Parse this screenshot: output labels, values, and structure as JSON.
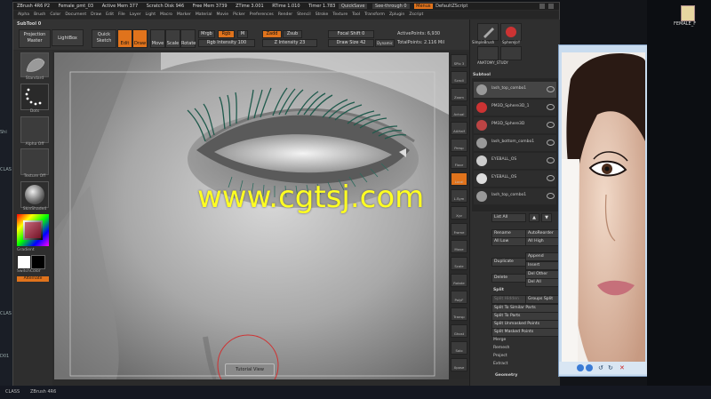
{
  "desktop": {
    "left_labels": [
      "Shi",
      "CLAS",
      "CLAS",
      "D01"
    ],
    "right_folder_label": "FEMALE_F",
    "taskbar": [
      "CLASS",
      "ZBrush 4R6"
    ]
  },
  "zbrush": {
    "title_items": [
      "ZBrush 4R6 P2",
      "Female_pmt_03",
      "Active Mem 377",
      "Scratch Disk 946",
      "Free Mem 3739",
      "ZTime 3.001",
      "RTime 1.010",
      "Timer 1.783"
    ],
    "title_right": [
      "QuickSave",
      "See-through 0",
      "Menus",
      "DefaultZScript"
    ],
    "menu": [
      "Alpha",
      "Brush",
      "Color",
      "Document",
      "Draw",
      "Edit",
      "File",
      "Layer",
      "Light",
      "Macro",
      "Marker",
      "Material",
      "Movie",
      "Picker",
      "Preferences",
      "Render",
      "Stencil",
      "Stroke",
      "Texture",
      "Tool",
      "Transform",
      "Zplugin",
      "Zscript"
    ],
    "toolbar": {
      "subtool_label": "SubTool 0",
      "projection_master": "Projection Master",
      "lightbox": "LightBox",
      "quick_sketch": "Quick Sketch",
      "edit": "Edit",
      "draw": "Draw",
      "move": "Move",
      "scale": "Scale",
      "rotate": "Rotate",
      "mrgb": "Mrgb",
      "rgb": "Rgb",
      "m": "M",
      "rgb_intensity": "Rgb Intensity 100",
      "zadd": "Zadd",
      "zsub": "Zsub",
      "z_intensity": "Z Intensity 23",
      "focal_shift": "Focal Shift 0",
      "draw_size": "Draw Size 42",
      "dynamic": "Dynamic",
      "active_points": "ActivePoints: 6,930",
      "total_points": "TotalPoints: 2.116 Mil"
    },
    "left_tray": {
      "labels": [
        "Standard",
        "Dots",
        "Alpha Off",
        "Texture Off",
        "SkinShade4",
        "Gradient",
        "SwitchColor",
        "Alternate"
      ]
    },
    "canvas": {
      "hint": "Tutorial View"
    },
    "shelf": [
      "SPix 3",
      "Scroll",
      "Zoom",
      "Actual",
      "AAHalf",
      "Persp",
      "Floor",
      "Local",
      "L.Sym",
      "Xyz",
      "Frame",
      "Move",
      "Scale",
      "Rotate",
      "PolyF",
      "Transp",
      "Ghost",
      "Solo",
      "Xpose"
    ],
    "right_tray": {
      "top_icons": [
        "SimpleBrush",
        "SphereJoY",
        "Cylinder3D",
        "PM3D_Sphere3D"
      ],
      "top_label": "ANATOMY_STUDY",
      "subtool_header": "Subtool",
      "subtools": [
        "lash_top_combo1",
        "PM3D_Sphere3D_1",
        "PM3D_Sphere3D",
        "lash_bottom_combo1",
        "EYEBALL_OS",
        "EYEBALL_OS",
        "lash_top_combo1"
      ],
      "list_all": "List All",
      "rename": "Rename",
      "auto_reorder": "AutoReorder",
      "all_low": "All Low",
      "all_high": "All High",
      "duplicate": "Duplicate",
      "append": "Append",
      "insert": "Insert",
      "delete": "Delete",
      "del_other": "Del Other",
      "del_all": "Del All",
      "split_header": "Split",
      "split_hidden": "Split Hidden",
      "groups_split": "Groups Split",
      "split_similar": "Split To Similar Parts",
      "split_parts": "Split To Parts",
      "split_unmasked": "Split Unmasked Points",
      "split_masked": "Split Masked Points",
      "merge": "Merge",
      "remesh": "Remesh",
      "project": "Project",
      "extract": "Extract",
      "geometry": "Geometry"
    }
  },
  "watermark": "www.cgtsj.com",
  "colors": {
    "accent": "#e0731c",
    "lash": "#2e6b5e",
    "watermark": "#ffff22"
  }
}
